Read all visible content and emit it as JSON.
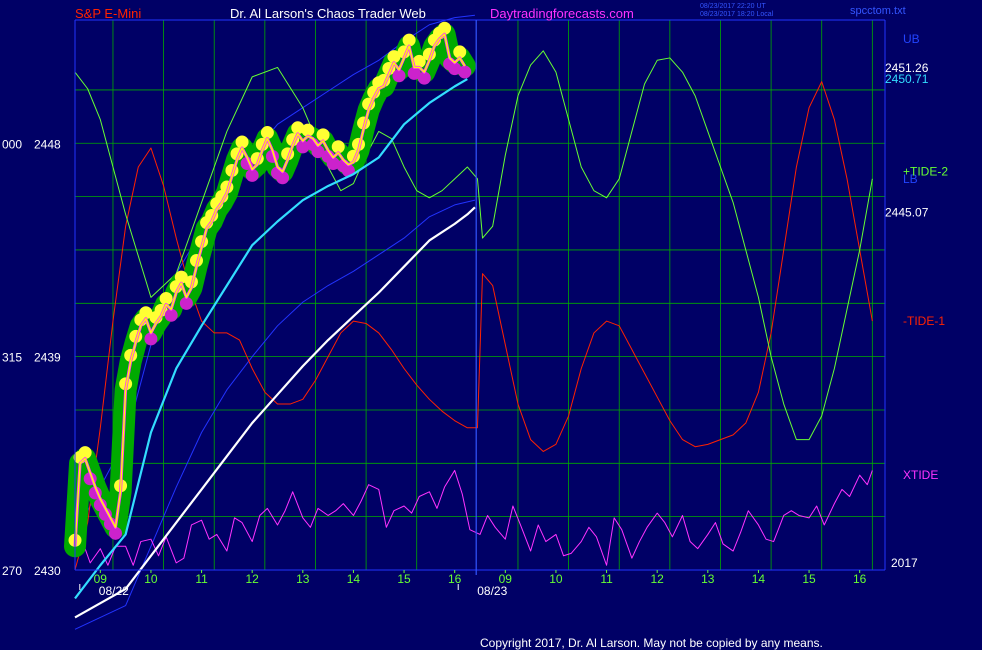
{
  "header": {
    "symbol": "S&P E-Mini",
    "site": "Dr. Al Larson's Chaos Trader Web",
    "url": "Daytradingforecasts.com",
    "utc_time": "08/23/2017 22:20 UT",
    "local_time": "08/23/2017 18:20 Local",
    "file": "spcctom.txt"
  },
  "footer": {
    "copyright": "Copyright 2017, Dr. Al Larson. May not be copied by any means."
  },
  "colors": {
    "background": "#000066",
    "grid": "#00aa00",
    "frame": "#3344ff",
    "price": "#ffff00",
    "price_glow": "#00aa00",
    "tide_plus": "#66ff33",
    "tide_minus": "#ff2200",
    "xtide": "#ff33ff",
    "ema_fast": "#33ddff",
    "ema_slow": "#ffffff",
    "band": "#2233ff",
    "vline": "#3355ff"
  },
  "chart_data": {
    "type": "line",
    "title": "S&P E-Mini",
    "xlim": [
      0,
      32
    ],
    "ylim": [
      2430,
      2453.2
    ],
    "y_ticks": [
      {
        "value": 2430,
        "label": "2430",
        "left": "270"
      },
      {
        "value": 2439,
        "label": "2439",
        "left": "315"
      },
      {
        "value": 2448,
        "label": "2448",
        "left": "000"
      }
    ],
    "x_ticks": [
      {
        "x": 1,
        "label": "09"
      },
      {
        "x": 3,
        "label": "10"
      },
      {
        "x": 5,
        "label": "11"
      },
      {
        "x": 7,
        "label": "12"
      },
      {
        "x": 9,
        "label": "13"
      },
      {
        "x": 11,
        "label": "14"
      },
      {
        "x": 13,
        "label": "15"
      },
      {
        "x": 15,
        "label": "16"
      },
      {
        "x": 17,
        "label": "09"
      },
      {
        "x": 19,
        "label": "10"
      },
      {
        "x": 21,
        "label": "11"
      },
      {
        "x": 23,
        "label": "12"
      },
      {
        "x": 25,
        "label": "13"
      },
      {
        "x": 27,
        "label": "14"
      },
      {
        "x": 29,
        "label": "15"
      },
      {
        "x": 31,
        "label": "16"
      }
    ],
    "date_labels": [
      {
        "x": 0.15,
        "label": "08/22"
      },
      {
        "x": 15.1,
        "label": "08/23"
      }
    ],
    "year_label": "2017",
    "day_divider_x": 15.85,
    "vertical_grid_x": [
      0,
      1.5,
      3.5,
      5.5,
      7.5,
      9.5,
      11.5,
      13.5,
      17.5,
      19.5,
      21.5,
      23.5,
      25.5,
      27.5,
      29.5,
      31.5,
      32
    ],
    "horizontal_grid_y": [
      2430,
      2432.25,
      2434.5,
      2436.75,
      2439,
      2441.25,
      2443.5,
      2445.75,
      2448,
      2450.25
    ],
    "price_labels": [
      {
        "value": 2451.26,
        "label": "2451.26",
        "color": "#ffffff"
      },
      {
        "value": 2450.71,
        "label": "2450.71",
        "color": "#33ddff"
      },
      {
        "value": 2445.07,
        "label": "2445.07",
        "color": "#ffffff"
      }
    ],
    "right_labels": [
      {
        "name": "UB",
        "label": "UB",
        "y": 2452.4,
        "color": "#2244ff"
      },
      {
        "name": "LB",
        "label": "LB",
        "y": 2446.5,
        "color": "#2244ff"
      },
      {
        "name": "tide-plus",
        "label": "+TIDE-2",
        "y": 2446.8,
        "color": "#66ff33"
      },
      {
        "name": "tide-minus",
        "label": "-TIDE-1",
        "y": 2440.5,
        "color": "#ff2200"
      },
      {
        "name": "xtide",
        "label": "XTIDE",
        "y": 2434.0,
        "color": "#ff33ff"
      }
    ],
    "series": [
      {
        "key": "price",
        "x": [
          0,
          0.2,
          0.4,
          0.6,
          0.8,
          1.0,
          1.2,
          1.4,
          1.6,
          1.8,
          2.0,
          2.2,
          2.4,
          2.6,
          2.8,
          3.0,
          3.2,
          3.4,
          3.6,
          3.8,
          4.0,
          4.2,
          4.4,
          4.6,
          4.8,
          5.0,
          5.2,
          5.4,
          5.6,
          5.8,
          6.0,
          6.2,
          6.4,
          6.6,
          6.8,
          7.0,
          7.2,
          7.4,
          7.6,
          7.8,
          8.0,
          8.2,
          8.4,
          8.6,
          8.8,
          9.0,
          9.2,
          9.4,
          9.6,
          9.8,
          10.0,
          10.2,
          10.4,
          10.6,
          10.8,
          11.0,
          11.2,
          11.4,
          11.6,
          11.8,
          12.0,
          12.2,
          12.4,
          12.6,
          12.8,
          13.0,
          13.2,
          13.4,
          13.6,
          13.8,
          14.0,
          14.2,
          14.4,
          14.6,
          14.8,
          15.0,
          15.2,
          15.4
        ],
        "y": [
          2431.0,
          2434.5,
          2434.7,
          2434.1,
          2433.5,
          2433.0,
          2432.6,
          2432.2,
          2431.8,
          2433.3,
          2437.6,
          2438.8,
          2439.6,
          2440.3,
          2440.6,
          2440.0,
          2440.4,
          2440.7,
          2441.2,
          2441.0,
          2441.7,
          2442.1,
          2441.5,
          2441.9,
          2442.8,
          2443.6,
          2444.4,
          2444.7,
          2445.2,
          2445.5,
          2445.9,
          2446.6,
          2447.3,
          2447.8,
          2447.4,
          2446.9,
          2447.1,
          2447.7,
          2448.2,
          2447.7,
          2447.0,
          2446.8,
          2447.3,
          2447.9,
          2448.4,
          2448.1,
          2448.3,
          2448.2,
          2447.9,
          2448.1,
          2447.7,
          2447.4,
          2447.6,
          2447.3,
          2447.1,
          2447.2,
          2447.7,
          2448.6,
          2449.4,
          2449.9,
          2450.3,
          2450.4,
          2450.9,
          2451.4,
          2451.1,
          2451.6,
          2452.1,
          2451.2,
          2451.2,
          2451.0,
          2451.5,
          2452.1,
          2452.4,
          2452.6,
          2451.6,
          2451.4,
          2451.6,
          2451.26
        ]
      },
      {
        "key": "ema_fast",
        "x": [
          0,
          1,
          2,
          3,
          4,
          5,
          6,
          7,
          8,
          9,
          10,
          11,
          12,
          13,
          14,
          15,
          15.5
        ],
        "y": [
          2428.8,
          2430.2,
          2431.5,
          2435.8,
          2438.5,
          2440.3,
          2442.0,
          2443.7,
          2444.7,
          2445.6,
          2446.2,
          2446.7,
          2447.4,
          2448.8,
          2449.7,
          2450.4,
          2450.71
        ]
      },
      {
        "key": "ema_slow",
        "x": [
          0,
          1,
          2,
          3,
          4,
          5,
          6,
          7,
          8,
          9,
          10,
          11,
          12,
          13,
          14,
          15,
          15.5,
          15.8
        ],
        "y": [
          2428.0,
          2428.6,
          2429.2,
          2430.6,
          2432.0,
          2433.4,
          2434.8,
          2436.2,
          2437.4,
          2438.6,
          2439.7,
          2440.7,
          2441.7,
          2442.8,
          2443.9,
          2444.6,
          2445.0,
          2445.3
        ]
      },
      {
        "key": "band_upper",
        "x": [
          0,
          1,
          2,
          3,
          4,
          5,
          6,
          7,
          8,
          9,
          10,
          11,
          12,
          13,
          14,
          15,
          15.8
        ],
        "y": [
          2431.5,
          2433.5,
          2435.5,
          2439.5,
          2442.5,
          2444.3,
          2446.0,
          2447.5,
          2448.8,
          2449.5,
          2450.2,
          2450.9,
          2451.5,
          2452.3,
          2453.0,
          2453.3,
          2453.4
        ]
      },
      {
        "key": "band_lower",
        "x": [
          0,
          1,
          2,
          3,
          4,
          5,
          6,
          7,
          8,
          9,
          10,
          11,
          12,
          13,
          14,
          15,
          15.8
        ],
        "y": [
          2427.5,
          2428.0,
          2428.5,
          2431.0,
          2433.5,
          2435.8,
          2437.6,
          2439.0,
          2440.3,
          2441.3,
          2442.0,
          2442.6,
          2443.3,
          2444.0,
          2444.9,
          2445.4,
          2445.6
        ]
      },
      {
        "key": "tide_plus",
        "x": [
          0,
          0.5,
          1,
          1.5,
          2,
          3,
          4,
          5,
          6,
          7,
          8,
          9,
          10,
          10.5,
          11,
          11.5,
          12,
          12.5,
          13,
          13.5,
          14,
          14.5,
          15,
          15.5,
          15.9,
          16.1,
          16.5,
          17,
          17.5,
          18,
          18.5,
          19,
          19.5,
          20,
          20.5,
          21,
          21.5,
          22,
          22.5,
          23,
          23.5,
          24,
          24.5,
          25,
          25.5,
          26,
          26.5,
          27,
          27.5,
          28,
          28.5,
          29,
          29.5,
          30,
          30.5,
          31,
          31.5
        ],
        "y": [
          2451.0,
          2450.3,
          2449.0,
          2447.0,
          2445.0,
          2441.5,
          2442.5,
          2445.5,
          2448.5,
          2450.8,
          2451.2,
          2449.5,
          2447.0,
          2446.0,
          2446.3,
          2447.5,
          2448.5,
          2448.2,
          2447.0,
          2446.0,
          2445.7,
          2446.0,
          2446.5,
          2447.0,
          2446.5,
          2444.0,
          2444.5,
          2447.5,
          2450.0,
          2451.3,
          2451.9,
          2451.0,
          2449.0,
          2447.0,
          2446.0,
          2445.7,
          2446.5,
          2448.5,
          2450.5,
          2451.5,
          2451.6,
          2451.0,
          2450.0,
          2448.5,
          2447.0,
          2445.5,
          2443.5,
          2441.5,
          2439.0,
          2437.0,
          2435.5,
          2435.5,
          2436.5,
          2438.5,
          2441.0,
          2443.5,
          2446.5
        ]
      },
      {
        "key": "tide_minus",
        "x": [
          0,
          0.5,
          1,
          1.5,
          2,
          2.5,
          3,
          3.5,
          4,
          4.5,
          5,
          5.5,
          6,
          6.5,
          7,
          7.5,
          8,
          8.5,
          9,
          9.5,
          10,
          10.5,
          11,
          11.5,
          12,
          12.5,
          13,
          13.5,
          14,
          14.5,
          15,
          15.5,
          15.9,
          16.1,
          16.5,
          17,
          17.5,
          18,
          18.5,
          19,
          19.5,
          20,
          20.5,
          21,
          21.5,
          22,
          22.5,
          23,
          23.5,
          24,
          24.5,
          25,
          25.5,
          26,
          26.5,
          27,
          27.5,
          28,
          28.5,
          29,
          29.5,
          30,
          30.5,
          31,
          31.5
        ],
        "y": [
          2430.0,
          2432.0,
          2436.0,
          2440.5,
          2444.5,
          2447.0,
          2447.8,
          2446.2,
          2444.0,
          2442.0,
          2440.5,
          2440.0,
          2440.0,
          2439.7,
          2438.5,
          2437.5,
          2437.0,
          2437.0,
          2437.2,
          2438.0,
          2439.0,
          2440.0,
          2440.5,
          2440.4,
          2440.0,
          2439.3,
          2438.5,
          2437.8,
          2437.2,
          2436.7,
          2436.3,
          2436.0,
          2436.0,
          2442.5,
          2442.0,
          2439.5,
          2437.0,
          2435.5,
          2435.0,
          2435.3,
          2436.5,
          2438.5,
          2440.0,
          2440.5,
          2440.3,
          2439.3,
          2438.3,
          2437.3,
          2436.3,
          2435.5,
          2435.2,
          2435.3,
          2435.5,
          2435.7,
          2436.2,
          2437.5,
          2440.0,
          2443.5,
          2447.0,
          2449.5,
          2450.6,
          2449.0,
          2446.5,
          2443.5,
          2440.5
        ]
      },
      {
        "key": "xtide",
        "x": [
          0,
          0.3,
          0.6,
          1.0,
          1.3,
          1.6,
          2.0,
          2.3,
          2.6,
          3.0,
          3.3,
          3.6,
          4.0,
          4.3,
          4.6,
          5.0,
          5.3,
          5.6,
          6.0,
          6.3,
          6.6,
          7.0,
          7.3,
          7.6,
          8.0,
          8.3,
          8.6,
          9.0,
          9.3,
          9.6,
          10.0,
          10.3,
          10.6,
          11.0,
          11.3,
          11.6,
          12.0,
          12.3,
          12.6,
          13.0,
          13.3,
          13.6,
          14.0,
          14.3,
          14.6,
          15.0,
          15.3,
          15.6,
          16.0,
          16.3,
          16.6,
          17.0,
          17.3,
          17.6,
          18.0,
          18.3,
          18.6,
          19.0,
          19.3,
          19.6,
          20.0,
          20.3,
          20.6,
          21.0,
          21.3,
          21.6,
          22.0,
          22.3,
          22.6,
          23.0,
          23.3,
          23.6,
          24.0,
          24.3,
          24.6,
          25.0,
          25.3,
          25.6,
          26.0,
          26.3,
          26.6,
          27.0,
          27.3,
          27.6,
          28.0,
          28.3,
          28.6,
          29.0,
          29.3,
          29.6,
          30.0,
          30.3,
          30.6,
          31.0,
          31.3,
          31.5
        ],
        "y": [
          2430.6,
          2431.2,
          2430.3,
          2430.9,
          2430.2,
          2431.0,
          2431.0,
          2430.2,
          2431.2,
          2431.3,
          2430.6,
          2431.4,
          2430.3,
          2430.5,
          2431.9,
          2432.1,
          2431.3,
          2431.5,
          2430.8,
          2432.2,
          2432.0,
          2431.2,
          2432.3,
          2432.6,
          2431.9,
          2432.5,
          2433.3,
          2432.2,
          2431.8,
          2432.6,
          2432.3,
          2432.5,
          2432.8,
          2432.3,
          2432.9,
          2433.6,
          2433.4,
          2431.8,
          2432.5,
          2432.7,
          2432.4,
          2433.1,
          2433.3,
          2432.6,
          2433.5,
          2434.2,
          2433.2,
          2431.7,
          2431.5,
          2432.3,
          2431.8,
          2431.3,
          2432.7,
          2431.9,
          2430.8,
          2431.9,
          2431.2,
          2431.5,
          2430.6,
          2430.7,
          2431.2,
          2431.8,
          2431.4,
          2430.2,
          2432.2,
          2431.7,
          2430.5,
          2431.2,
          2431.8,
          2432.4,
          2432.0,
          2431.4,
          2432.3,
          2431.2,
          2430.9,
          2431.5,
          2432.0,
          2431.1,
          2430.8,
          2431.6,
          2432.5,
          2431.9,
          2431.3,
          2431.2,
          2432.3,
          2432.5,
          2432.3,
          2432.2,
          2432.7,
          2431.9,
          2432.8,
          2433.4,
          2433.1,
          2434.0,
          2433.6,
          2434.2
        ]
      }
    ]
  }
}
